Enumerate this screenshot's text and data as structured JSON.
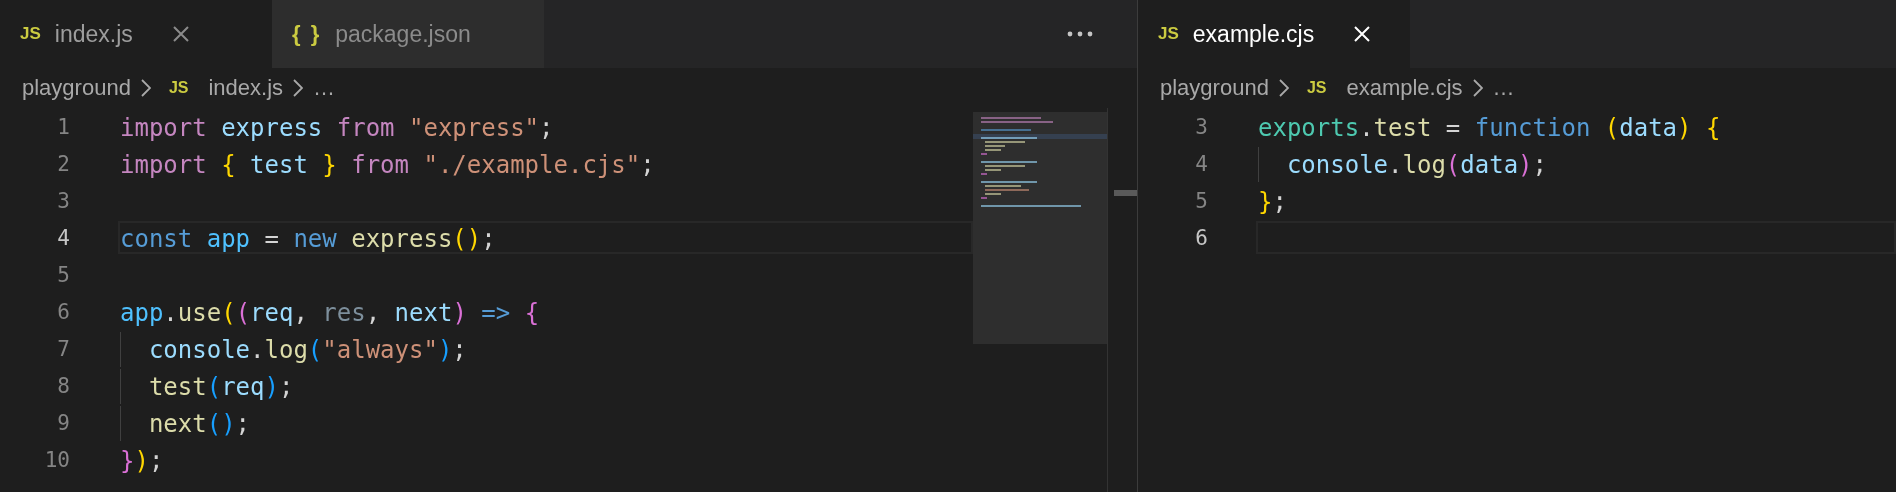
{
  "editors": [
    {
      "focused": false,
      "show_more_actions": true,
      "minimap": true,
      "tabs": [
        {
          "icon": "JS",
          "kind": "js",
          "label": "index.js",
          "selected": true
        },
        {
          "icon": "{ }",
          "kind": "json",
          "label": "package.json",
          "selected": false
        }
      ],
      "breadcrumbs": [
        {
          "label": "playground"
        },
        {
          "label": "index.js",
          "icon": "JS"
        },
        {
          "label": "…"
        }
      ],
      "lines": [
        {
          "number": "1",
          "current": false,
          "tokens": [
            {
              "text": "import",
              "kind": "keyword"
            },
            {
              "text": " express",
              "kind": "variable"
            },
            {
              "text": " from",
              "kind": "keyword"
            },
            {
              "text": " \"express\"",
              "kind": "string"
            },
            {
              "text": ";",
              "kind": "punct"
            }
          ]
        },
        {
          "number": "2",
          "current": false,
          "tokens": [
            {
              "text": "import",
              "kind": "keyword"
            },
            {
              "text": " {",
              "kind": "bracket1"
            },
            {
              "text": " test",
              "kind": "variable"
            },
            {
              "text": " }",
              "kind": "bracket1"
            },
            {
              "text": " from",
              "kind": "keyword"
            },
            {
              "text": " \"./example.cjs\"",
              "kind": "string"
            },
            {
              "text": ";",
              "kind": "punct"
            }
          ]
        },
        {
          "number": "3",
          "current": false
        },
        {
          "number": "4",
          "current": true,
          "tokens": [
            {
              "text": "const",
              "kind": "storage"
            },
            {
              "text": " app",
              "kind": "constant"
            },
            {
              "text": " =",
              "kind": "punct"
            },
            {
              "text": " new",
              "kind": "storage"
            },
            {
              "text": " express",
              "kind": "function"
            },
            {
              "text": "()",
              "kind": "bracket1"
            },
            {
              "text": ";",
              "kind": "punct"
            }
          ]
        },
        {
          "number": "5",
          "current": false
        },
        {
          "number": "6",
          "current": false,
          "tokens": [
            {
              "text": "app",
              "kind": "constant"
            },
            {
              "text": ".",
              "kind": "punct"
            },
            {
              "text": "use",
              "kind": "function"
            },
            {
              "text": "(",
              "kind": "bracket1"
            },
            {
              "text": "(",
              "kind": "bracket2"
            },
            {
              "text": "req",
              "kind": "variable"
            },
            {
              "text": ",",
              "kind": "punct"
            },
            {
              "text": " res",
              "kind": "unused"
            },
            {
              "text": ",",
              "kind": "punct"
            },
            {
              "text": " next",
              "kind": "variable"
            },
            {
              "text": ")",
              "kind": "bracket2"
            },
            {
              "text": " =>",
              "kind": "storage"
            },
            {
              "text": " {",
              "kind": "bracket2"
            }
          ]
        },
        {
          "number": "7",
          "current": false,
          "tokens": [
            {
              "text": "  console",
              "kind": "variable"
            },
            {
              "text": ".",
              "kind": "punct"
            },
            {
              "text": "log",
              "kind": "function"
            },
            {
              "text": "(",
              "kind": "bracket3"
            },
            {
              "text": "\"always\"",
              "kind": "string"
            },
            {
              "text": ")",
              "kind": "bracket3"
            },
            {
              "text": ";",
              "kind": "punct"
            }
          ]
        },
        {
          "number": "8",
          "current": false,
          "tokens": [
            {
              "text": "  test",
              "kind": "function"
            },
            {
              "text": "(",
              "kind": "bracket3"
            },
            {
              "text": "req",
              "kind": "variable"
            },
            {
              "text": ")",
              "kind": "bracket3"
            },
            {
              "text": ";",
              "kind": "punct"
            }
          ]
        },
        {
          "number": "9",
          "current": false,
          "tokens": [
            {
              "text": "  next",
              "kind": "function"
            },
            {
              "text": "()",
              "kind": "bracket3"
            },
            {
              "text": ";",
              "kind": "punct"
            }
          ]
        },
        {
          "number": "10",
          "current": false,
          "tokens": [
            {
              "text": "}",
              "kind": "bracket2"
            },
            {
              "text": ")",
              "kind": "bracket1"
            },
            {
              "text": ";",
              "kind": "punct"
            }
          ]
        }
      ]
    },
    {
      "focused": true,
      "show_more_actions": false,
      "minimap": false,
      "tabs": [
        {
          "icon": "JS",
          "kind": "js",
          "label": "example.cjs",
          "selected": true
        }
      ],
      "breadcrumbs": [
        {
          "label": "playground"
        },
        {
          "label": "example.cjs",
          "icon": "JS"
        },
        {
          "label": "…"
        }
      ],
      "lines": [
        {
          "number": "3",
          "current": false,
          "tokens": [
            {
              "text": "exports",
              "kind": "class"
            },
            {
              "text": ".",
              "kind": "punct"
            },
            {
              "text": "test",
              "kind": "function"
            },
            {
              "text": " =",
              "kind": "punct"
            },
            {
              "text": " function",
              "kind": "storage"
            },
            {
              "text": " (",
              "kind": "bracket1"
            },
            {
              "text": "data",
              "kind": "variable"
            },
            {
              "text": ")",
              "kind": "bracket1"
            },
            {
              "text": " {",
              "kind": "bracket1"
            }
          ]
        },
        {
          "number": "4",
          "current": false,
          "tokens": [
            {
              "text": "  console",
              "kind": "variable"
            },
            {
              "text": ".",
              "kind": "punct"
            },
            {
              "text": "log",
              "kind": "function"
            },
            {
              "text": "(",
              "kind": "bracket2"
            },
            {
              "text": "data",
              "kind": "variable"
            },
            {
              "text": ")",
              "kind": "bracket2"
            },
            {
              "text": ";",
              "kind": "punct"
            }
          ]
        },
        {
          "number": "5",
          "current": false,
          "tokens": [
            {
              "text": "}",
              "kind": "bracket1"
            },
            {
              "text": ";",
              "kind": "punct"
            }
          ]
        },
        {
          "number": "6",
          "current": true
        }
      ]
    }
  ]
}
